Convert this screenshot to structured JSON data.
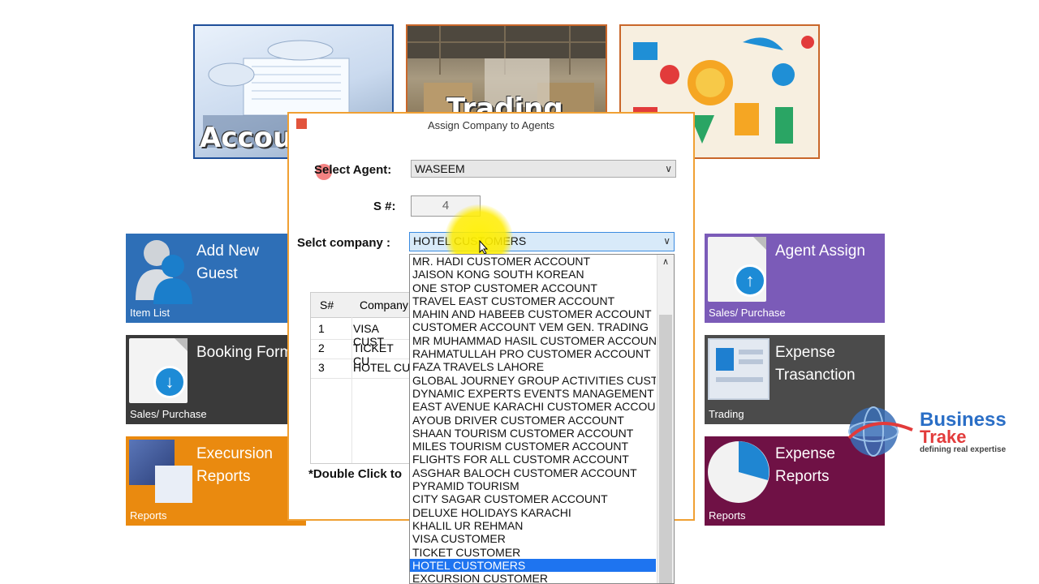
{
  "photos": {
    "accounts_caption": "Accou",
    "trading_caption": "Trading"
  },
  "tiles": {
    "add_guest": {
      "title": "Add New Guest",
      "sub": "Item List",
      "color": "#2e6fb7"
    },
    "booking": {
      "title": "Booking Form",
      "sub": "Sales/ Purchase",
      "color": "#3a3a3a"
    },
    "excursion": {
      "title": "Execursion Reports",
      "sub": "Reports",
      "color": "#ea8a0f"
    },
    "agent_assign": {
      "title": "Agent Assign",
      "sub": "Sales/ Purchase",
      "color": "#7b5bb8"
    },
    "expense_tx": {
      "title": "Expense Trasanction",
      "sub": "Trading",
      "color": "#4b4b4b"
    },
    "expense_reports": {
      "title": "Expense Reports",
      "sub": "Reports",
      "color": "#6f1145"
    }
  },
  "dialog": {
    "title": "Assign Company to Agents",
    "agent_label": "Select Agent:",
    "agent_value": "WASEEM",
    "sno_label": "S #:",
    "sno_value": "4",
    "company_label": "Selct company :",
    "company_value": "HOTEL CUSTOMERS",
    "grid_headers": [
      "S#",
      "Company"
    ],
    "grid_rows": [
      {
        "n": "1",
        "c": "VISA CUST"
      },
      {
        "n": "2",
        "c": "TICKET CU"
      },
      {
        "n": "3",
        "c": "HOTEL CU"
      }
    ],
    "note": "*Double Click to"
  },
  "dropdown_items": [
    "MR. HADI CUSTOMER ACCOUNT",
    "JAISON KONG SOUTH KOREAN",
    "ONE STOP CUSTOMER ACCOUNT",
    "TRAVEL EAST CUSTOMER ACCOUNT",
    "MAHIN AND HABEEB CUSTOMER ACCOUNT",
    "CUSTOMER ACCOUNT VEM GEN. TRADING",
    "MR MUHAMMAD HASIL CUSTOMER ACCOUNT",
    "RAHMATULLAH PRO CUSTOMER ACCOUNT",
    "FAZA TRAVELS LAHORE",
    "GLOBAL JOURNEY GROUP ACTIVITIES CUSTOI",
    "DYNAMIC EXPERTS EVENTS MANAGEMENT CU",
    "EAST AVENUE KARACHI CUSTOMER ACCOUNT",
    "AYOUB DRIVER CUSTOMER ACCOUNT",
    "SHAAN TOURISM CUSTOMER ACCOUNT",
    "MILES TOURISM CUSTOMER ACCOUNT",
    "FLIGHTS FOR ALL CUSTOMR ACCOUNT",
    "ASGHAR BALOCH CUSTOMER ACCOUNT",
    "PYRAMID TOURISM",
    "CITY SAGAR CUSTOMER ACCOUNT",
    "DELUXE HOLIDAYS KARACHI",
    "KHALIL UR REHMAN",
    "VISA CUSTOMER",
    "TICKET CUSTOMER",
    "HOTEL CUSTOMERS",
    "EXCURSION CUSTOMER"
  ],
  "selected_item": "HOTEL CUSTOMERS",
  "logo": {
    "line1": "Business",
    "line2": "Trake",
    "tagline": "defining real expertise"
  }
}
